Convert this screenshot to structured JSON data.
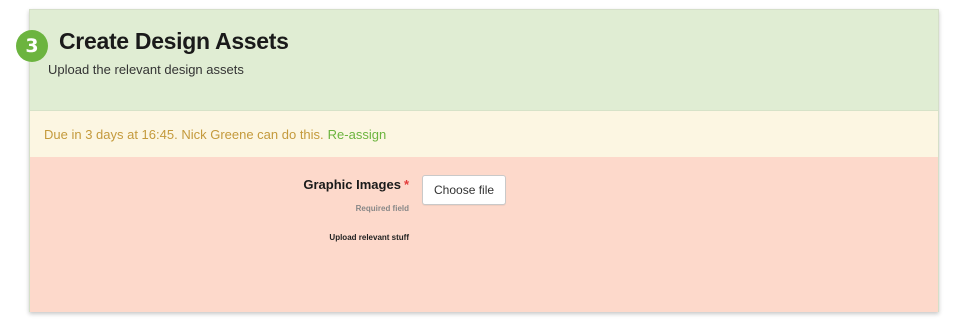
{
  "step": {
    "number": "3",
    "title": "Create Design Assets",
    "subtitle": "Upload the relevant design assets"
  },
  "due": {
    "text": "Due in 3 days at 16:45. Nick Greene can do this.",
    "reassign_label": "Re-assign"
  },
  "form": {
    "field_label": "Graphic Images",
    "required_marker": "*",
    "required_note": "Required field",
    "help_text": "Upload relevant stuff",
    "file_button_label": "Choose file"
  },
  "colors": {
    "accent_green": "#6cb43f",
    "header_bg": "#e0edd3",
    "due_bg": "#fcf6e2",
    "due_text": "#c49a3c",
    "error_bg": "#fdd9cb",
    "required_red": "#e23b3b"
  }
}
